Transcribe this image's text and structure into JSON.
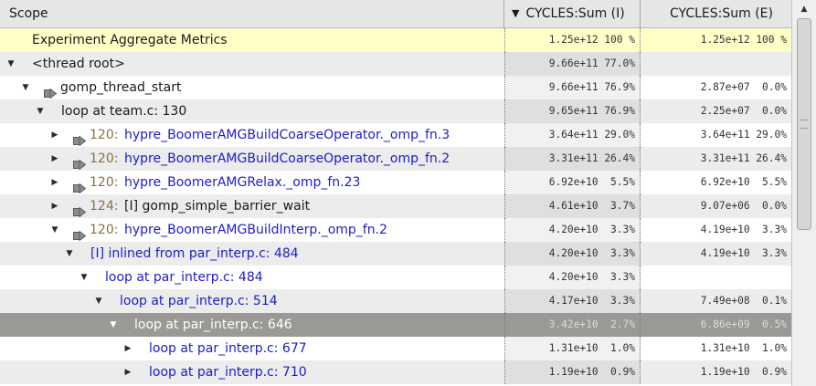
{
  "header": {
    "scope": "Scope",
    "sort_icon": "sort-descending-icon",
    "inclusive": "CYCLES:Sum (I)",
    "exclusive": "CYCLES:Sum (E)"
  },
  "rows": [
    {
      "label": "Experiment Aggregate Metrics",
      "lineno": "",
      "incl": "1.25e+12 100 %",
      "excl": "1.25e+12 100 %",
      "twisty": "none",
      "callsite": false,
      "blue": false,
      "style": "agg"
    },
    {
      "label": "<thread root>",
      "lineno": "",
      "incl": "9.66e+11 77.0%",
      "excl": "",
      "twisty": "open",
      "callsite": false,
      "blue": false,
      "style": "alt"
    },
    {
      "label": "gomp_thread_start",
      "lineno": "",
      "incl": "9.66e+11 76.9%",
      "excl": "2.87e+07  0.0%",
      "twisty": "open",
      "callsite": true,
      "blue": false,
      "style": ""
    },
    {
      "label": "loop at team.c: 130",
      "lineno": "",
      "incl": "9.65e+11 76.9%",
      "excl": "2.25e+07  0.0%",
      "twisty": "open",
      "callsite": false,
      "blue": false,
      "style": "alt"
    },
    {
      "label": "hypre_BoomerAMGBuildCoarseOperator._omp_fn.3",
      "lineno": "120:",
      "incl": "3.64e+11 29.0%",
      "excl": "3.64e+11 29.0%",
      "twisty": "closed",
      "callsite": true,
      "blue": true,
      "style": ""
    },
    {
      "label": "hypre_BoomerAMGBuildCoarseOperator._omp_fn.2",
      "lineno": "120:",
      "incl": "3.31e+11 26.4%",
      "excl": "3.31e+11 26.4%",
      "twisty": "closed",
      "callsite": true,
      "blue": true,
      "style": "alt"
    },
    {
      "label": "hypre_BoomerAMGRelax._omp_fn.23",
      "lineno": "120:",
      "incl": "6.92e+10  5.5%",
      "excl": "6.92e+10  5.5%",
      "twisty": "closed",
      "callsite": true,
      "blue": true,
      "style": ""
    },
    {
      "label": "[I] gomp_simple_barrier_wait",
      "lineno": "124:",
      "incl": "4.61e+10  3.7%",
      "excl": "9.07e+06  0.0%",
      "twisty": "closed",
      "callsite": true,
      "blue": false,
      "style": "alt"
    },
    {
      "label": "hypre_BoomerAMGBuildInterp._omp_fn.2",
      "lineno": "120:",
      "incl": "4.20e+10  3.3%",
      "excl": "4.19e+10  3.3%",
      "twisty": "open",
      "callsite": true,
      "blue": true,
      "style": ""
    },
    {
      "label": "[I] inlined from par_interp.c: 484",
      "lineno": "",
      "incl": "4.20e+10  3.3%",
      "excl": "4.19e+10  3.3%",
      "twisty": "open",
      "callsite": false,
      "blue": true,
      "style": "alt"
    },
    {
      "label": "loop at par_interp.c: 484",
      "lineno": "",
      "incl": "4.20e+10  3.3%",
      "excl": "",
      "twisty": "open",
      "callsite": false,
      "blue": true,
      "style": ""
    },
    {
      "label": "loop at par_interp.c: 514",
      "lineno": "",
      "incl": "4.17e+10  3.3%",
      "excl": "7.49e+08  0.1%",
      "twisty": "open",
      "callsite": false,
      "blue": true,
      "style": "alt"
    },
    {
      "label": "loop at par_interp.c: 646",
      "lineno": "",
      "incl": "3.42e+10  2.7%",
      "excl": "6.86e+09  0.5%",
      "twisty": "open",
      "callsite": false,
      "blue": false,
      "style": "sel"
    },
    {
      "label": "loop at par_interp.c: 677",
      "lineno": "",
      "incl": "1.31e+10  1.0%",
      "excl": "1.31e+10  1.0%",
      "twisty": "closed",
      "callsite": false,
      "blue": true,
      "style": ""
    },
    {
      "label": "loop at par_interp.c: 710",
      "lineno": "",
      "incl": "1.19e+10  0.9%",
      "excl": "1.19e+10  0.9%",
      "twisty": "closed",
      "callsite": false,
      "blue": true,
      "style": "alt"
    }
  ],
  "scrollbar": {
    "up_icon": "scroll-up-arrow-icon"
  }
}
